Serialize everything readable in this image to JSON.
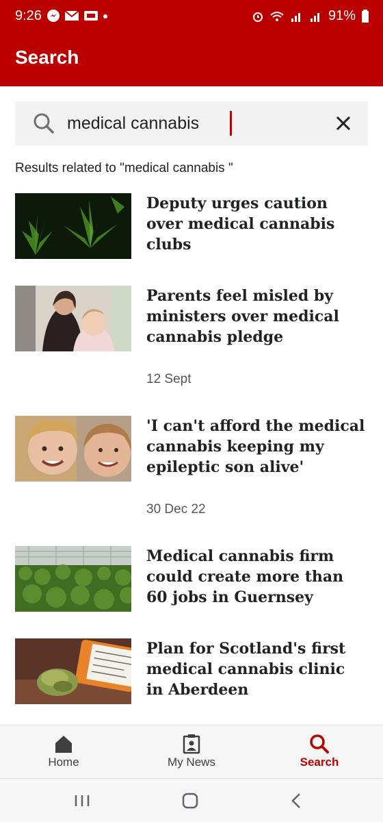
{
  "status_bar": {
    "time": "9:26",
    "battery": "91%",
    "left_icons": [
      "messenger-icon",
      "mail-icon",
      "gallery-icon",
      "dot-icon"
    ],
    "right_icons": [
      "alarm-icon",
      "wifi-icon",
      "signal-icon",
      "signal-r-icon",
      "battery-icon"
    ]
  },
  "header": {
    "title": "Search"
  },
  "search": {
    "value": "medical cannabis ",
    "placeholder": ""
  },
  "results_label": "Results related to \"medical cannabis \"",
  "results": [
    {
      "headline": "Deputy urges caution over medical cannabis clubs",
      "date": "",
      "thumbnail": "cannabis-leaves"
    },
    {
      "headline": "Parents feel misled by ministers over medical cannabis pledge",
      "date": "12 Sept",
      "thumbnail": "mother-and-child"
    },
    {
      "headline": "'I can't afford the medical cannabis keeping my epileptic son alive'",
      "date": "30 Dec 22",
      "thumbnail": "mother-and-son-selfie"
    },
    {
      "headline": "Medical cannabis firm could create more than 60 jobs in Guernsey",
      "date": "",
      "thumbnail": "greenhouse-plants"
    },
    {
      "headline": "Plan for Scotland's first medical cannabis clinic in Aberdeen",
      "date": "",
      "thumbnail": "prescription-bottle"
    }
  ],
  "bottom_nav": [
    {
      "label": "Home",
      "icon": "home-icon",
      "active": false
    },
    {
      "label": "My News",
      "icon": "my-news-icon",
      "active": false
    },
    {
      "label": "Search",
      "icon": "search-icon",
      "active": true
    }
  ],
  "system_nav": [
    "recents-icon",
    "home-circle-icon",
    "back-icon"
  ],
  "colors": {
    "brand": "#bb0000",
    "text": "#202224",
    "muted": "#545658"
  }
}
